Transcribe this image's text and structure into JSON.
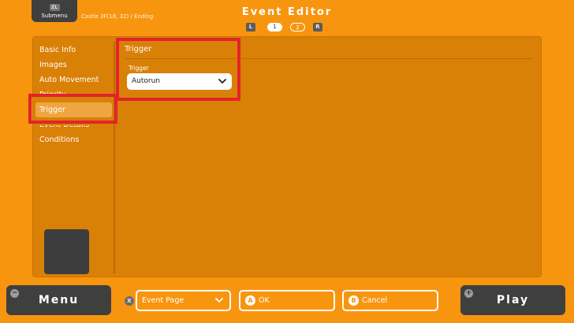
{
  "header": {
    "submenu_key": "ZL",
    "submenu_label": "Submenu",
    "breadcrumb": "Castle 3F(18, 32) / Ending",
    "title": "Event Editor",
    "pager": {
      "left_key": "L",
      "page1": "1",
      "page2": "2",
      "right_key": "R",
      "active_page": 1
    }
  },
  "sidebar": {
    "items": [
      {
        "label": "Basic Info"
      },
      {
        "label": "Images"
      },
      {
        "label": "Auto Movement"
      },
      {
        "label": "Priority"
      },
      {
        "label": "Trigger",
        "selected": true
      },
      {
        "label": "Event Details"
      },
      {
        "label": "Conditions"
      }
    ]
  },
  "content": {
    "heading": "Trigger",
    "field_label": "Trigger",
    "dropdown_value": "Autorun"
  },
  "footer": {
    "menu_key": "−",
    "menu_label": "Menu",
    "x_key": "X",
    "event_page_label": "Event Page",
    "ok_key": "A",
    "ok_label": "OK",
    "cancel_key": "B",
    "cancel_label": "Cancel",
    "play_key": "+",
    "play_label": "Play"
  },
  "colors": {
    "background": "#f7950f",
    "panel": "#d98006",
    "selected_item": "#f0a640",
    "highlight": "#e4222a",
    "dark_button": "#3f3f3f"
  }
}
